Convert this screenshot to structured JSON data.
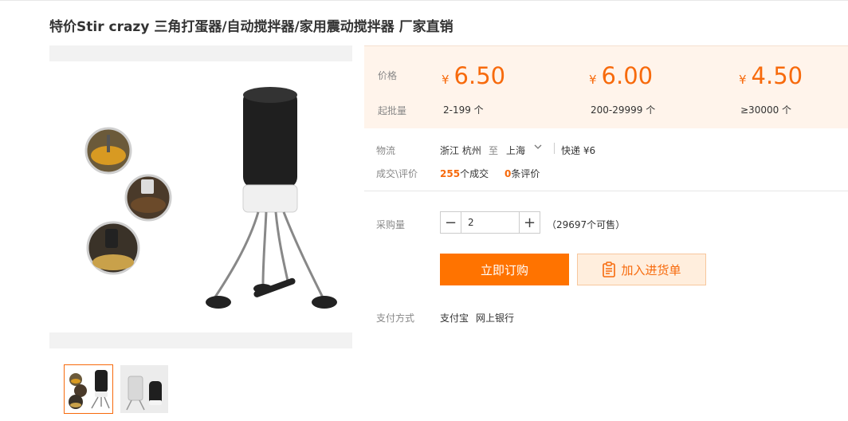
{
  "product": {
    "title": "特价Stir crazy 三角打蛋器/自动搅拌器/家用震动搅拌器 厂家直销"
  },
  "gallery": {
    "main_image": "stirrer-product-photo",
    "thumbnails": [
      "stirrer-photo-thumb-1",
      "stirrer-photo-thumb-2"
    ],
    "selected_index": 0
  },
  "pricing": {
    "price_label": "价格",
    "moq_label": "起批量",
    "currency_symbol": "¥",
    "tiers": [
      {
        "price": "6.50",
        "range": "2-199 个"
      },
      {
        "price": "6.00",
        "range": "200-29999 个"
      },
      {
        "price": "4.50",
        "range": "≥30000 个"
      }
    ]
  },
  "logistics": {
    "label": "物流",
    "origin": "浙江 杭州",
    "to": "至",
    "destination": "上海",
    "shipping": "快递 ¥6"
  },
  "deals": {
    "label": "成交\\评价",
    "transactions_count": "255",
    "transactions_text": "个成交",
    "reviews_count": "0",
    "reviews_text": "条评价"
  },
  "purchase": {
    "label": "采购量",
    "quantity": "2",
    "minus": "−",
    "plus": "+",
    "available": "（29697个可售）",
    "buy_label": "立即订购",
    "cart_label": "加入进货单"
  },
  "payment": {
    "label": "支付方式",
    "methods": [
      "支付宝",
      "网上银行"
    ]
  },
  "colors": {
    "accent": "#f76a0c",
    "buy_button": "#ff7300",
    "price_panel_bg": "#fff4eb"
  }
}
